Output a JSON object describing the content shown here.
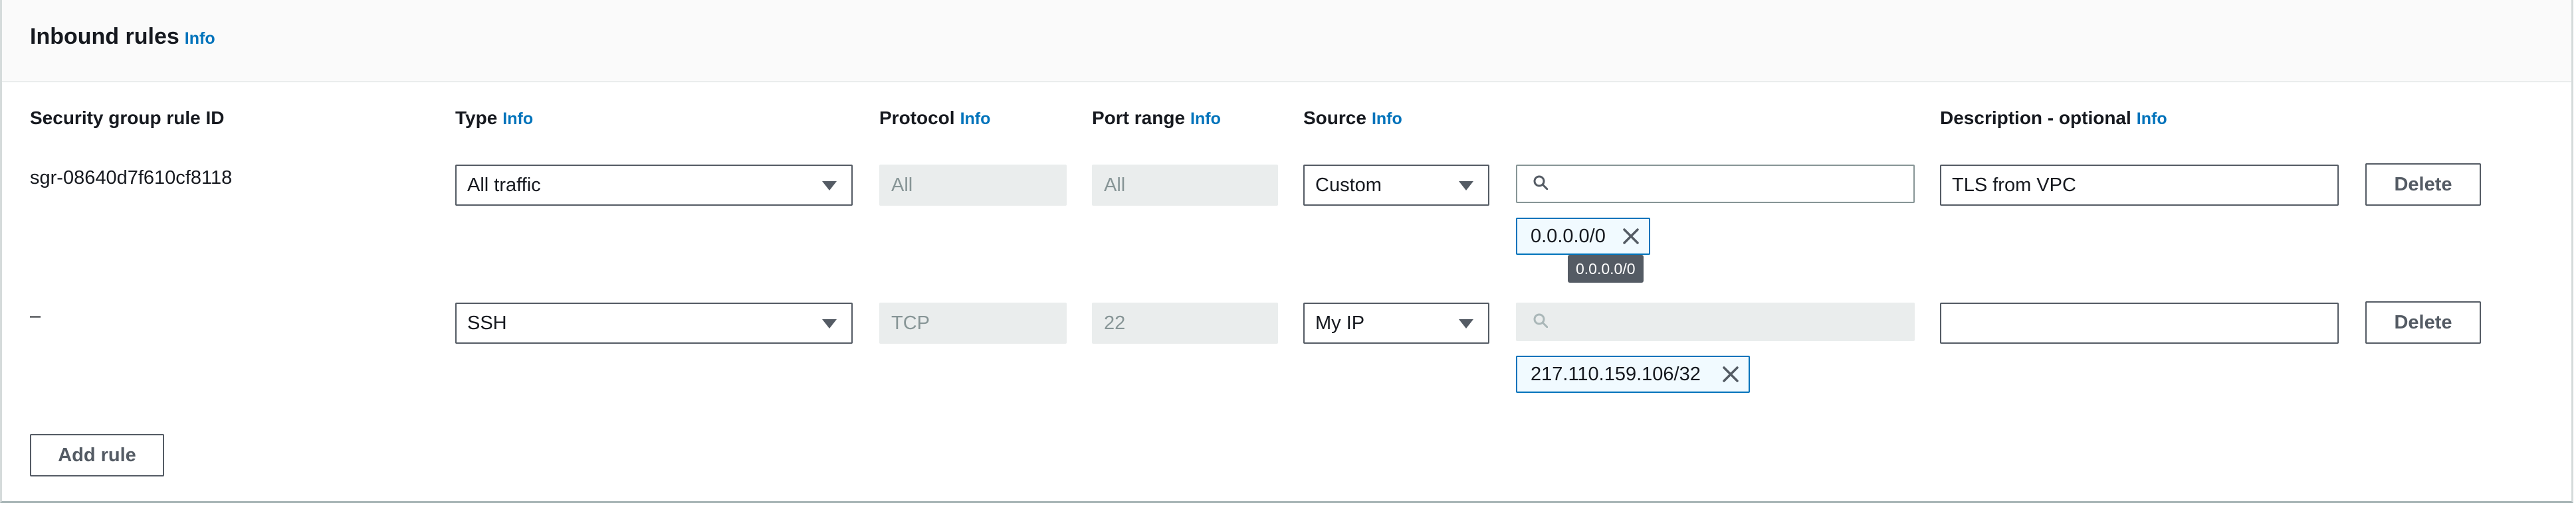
{
  "section": {
    "title": "Inbound rules",
    "info_label": "Info"
  },
  "columns": {
    "rule_id": "Security group rule ID",
    "type": "Type",
    "protocol": "Protocol",
    "port_range": "Port range",
    "source": "Source",
    "description": "Description - optional",
    "info_label": "Info"
  },
  "rules": [
    {
      "rule_id": "sgr-08640d7f610cf8118",
      "type": "All traffic",
      "protocol": "All",
      "port_range": "All",
      "source": "Custom",
      "source_search_placeholder": "",
      "source_token": "0.0.0.0/0",
      "source_token_tooltip": "0.0.0.0/0",
      "description": "TLS from VPC",
      "delete_label": "Delete"
    },
    {
      "rule_id": "–",
      "type": "SSH",
      "protocol": "TCP",
      "port_range": "22",
      "source": "My IP",
      "source_search_placeholder": "",
      "source_token": "217.110.159.106/32",
      "description": "",
      "delete_label": "Delete"
    }
  ],
  "add_rule_label": "Add rule",
  "icons": {
    "search": "search-icon",
    "dropdown": "caret-down-icon",
    "remove": "close-icon"
  },
  "colors": {
    "link": "#0073bb",
    "border": "#545b64",
    "disabled_bg": "#eaeded",
    "token_bg": "#f1faff"
  }
}
